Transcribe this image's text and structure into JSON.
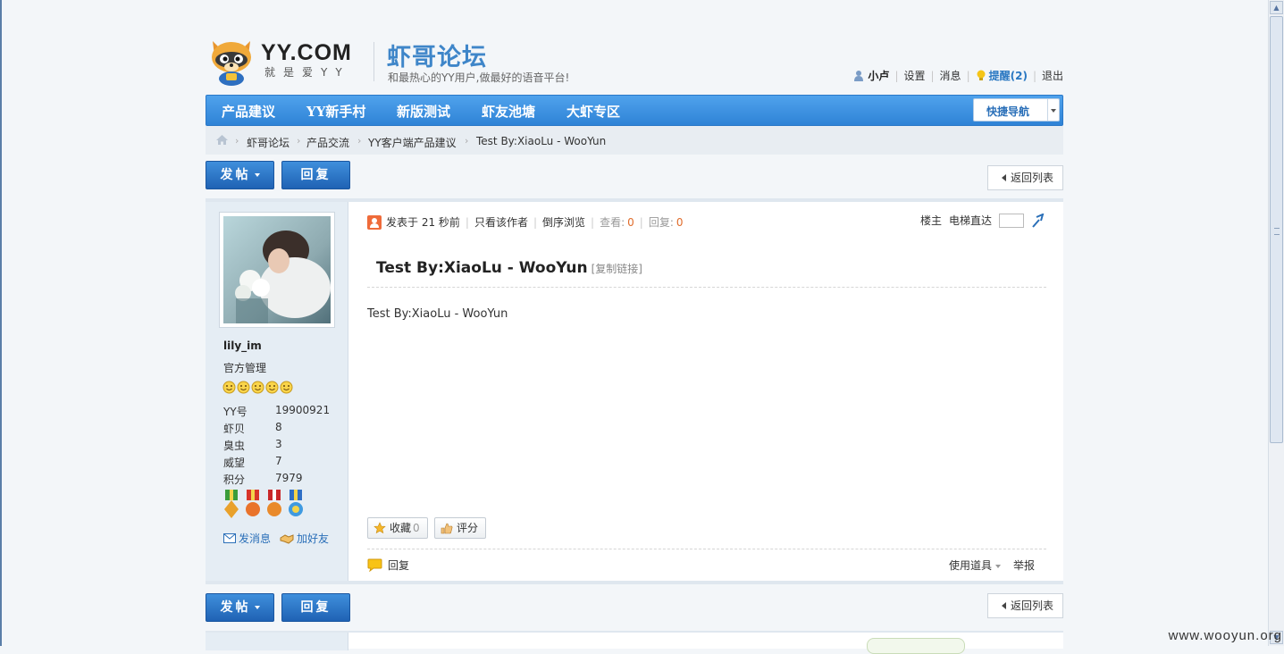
{
  "header": {
    "brand": "YY.COM",
    "slogan": "就是爱YY",
    "forum_name": "虾哥论坛",
    "tagline": "和最热心的YY用户,做最好的语音平台!"
  },
  "user_bar": {
    "username": "小卢",
    "settings": "设置",
    "messages": "消息",
    "alerts": "提醒(2)",
    "logout": "退出"
  },
  "nav": {
    "items": [
      "产品建议",
      "YY新手村",
      "新版测试",
      "虾友池塘",
      "大虾专区"
    ],
    "quick_nav": "快捷导航"
  },
  "breadcrumb": [
    "虾哥论坛",
    "产品交流",
    "YY客户端产品建议",
    "Test By:XiaoLu - WooYun"
  ],
  "actions": {
    "post_label": "发帖",
    "reply_label": "回复",
    "back_label": "返回列表"
  },
  "post": {
    "meta": {
      "posted_at": "发表于 21 秒前",
      "author_only": "只看该作者",
      "reverse_view": "倒序浏览",
      "views_label": "查看:",
      "views": "0",
      "replies_label": "回复:",
      "replies": "0",
      "floor": "楼主",
      "elevator": "电梯直达"
    },
    "title": "Test By:XiaoLu - WooYun",
    "copy_link": "[复制链接]",
    "body": "Test By:XiaoLu - WooYun",
    "favorite_label": "收藏",
    "favorite_count": "0",
    "rate_label": "评分",
    "reply_label": "回复",
    "tools_label": "使用道具",
    "report_label": "举报"
  },
  "author": {
    "name": "lily_im",
    "group": "官方管理",
    "stats": [
      {
        "label": "YY号",
        "value": "19900921"
      },
      {
        "label": "虾贝",
        "value": "8"
      },
      {
        "label": "臭虫",
        "value": "3"
      },
      {
        "label": "威望",
        "value": "7"
      },
      {
        "label": "积分",
        "value": "7979"
      }
    ],
    "send_message": "发消息",
    "add_friend": "加好友"
  },
  "watermark": "www.wooyun.org",
  "colors": {
    "nav_blue": "#3a8fe0",
    "link_blue": "#2a6fb8",
    "count_orange": "#e06b2a"
  }
}
